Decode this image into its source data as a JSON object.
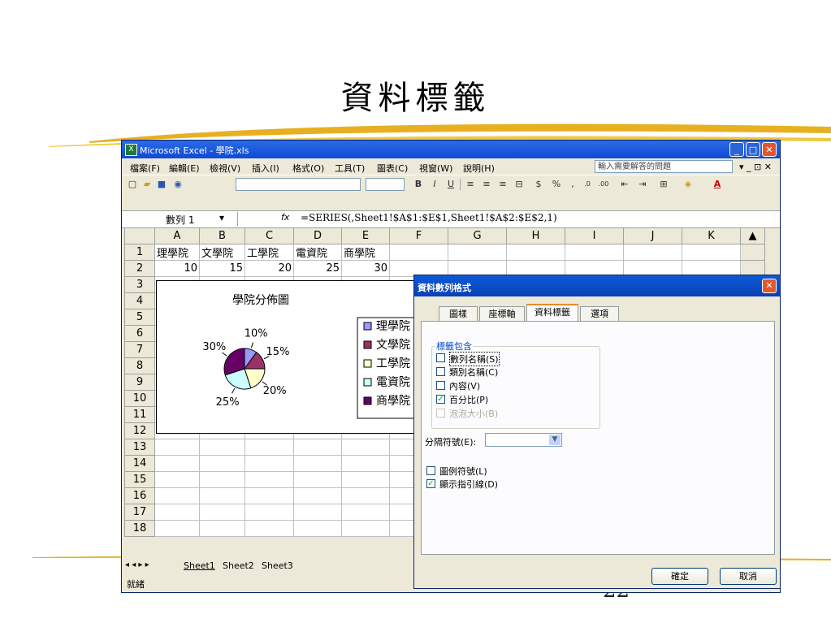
{
  "slide": {
    "title": "資料標籤",
    "page_number": "22"
  },
  "window": {
    "title": "Microsoft Excel - 學院.xls"
  },
  "menu": [
    "檔案(F)",
    "編輯(E)",
    "檢視(V)",
    "插入(I)",
    "格式(O)",
    "工具(T)",
    "圖表(C)",
    "視窗(W)",
    "說明(H)"
  ],
  "help_placeholder": "輸入需要解答的問題",
  "formula": {
    "name_box": "數列 1",
    "fx": "fx",
    "content": "=SERIES(,Sheet1!$A$1:$E$1,Sheet1!$A$2:$E$2,1)"
  },
  "columns": [
    "A",
    "B",
    "C",
    "D",
    "E",
    "F",
    "G",
    "H",
    "I",
    "J",
    "K"
  ],
  "rows": [
    "1",
    "2",
    "3",
    "4",
    "5",
    "6",
    "7",
    "8",
    "9",
    "10",
    "11",
    "12",
    "13",
    "14",
    "15",
    "16",
    "17",
    "18"
  ],
  "row1": [
    "理學院",
    "文學院",
    "工學院",
    "電資院",
    "商學院"
  ],
  "row2": [
    "10",
    "15",
    "20",
    "25",
    "30"
  ],
  "chart_data": {
    "type": "pie",
    "title": "學院分佈圖",
    "categories": [
      "理學院",
      "文學院",
      "工學院",
      "電資院",
      "商學院"
    ],
    "values": [
      10,
      15,
      20,
      25,
      30
    ],
    "data_labels": [
      "10%",
      "15%",
      "20%",
      "25%",
      "30%"
    ],
    "colors": [
      "#9999ff",
      "#993366",
      "#ffffcc",
      "#ccffff",
      "#660066"
    ],
    "legend": "right"
  },
  "sheet_tabs": [
    "Sheet1",
    "Sheet2",
    "Sheet3"
  ],
  "status": "就緒",
  "dialog": {
    "title": "資料數列格式",
    "tabs": [
      "圖樣",
      "座標軸",
      "資料標籤",
      "選項"
    ],
    "group_label": "標籤包含",
    "options": [
      {
        "label": "數列名稱(S)",
        "checked": false
      },
      {
        "label": "類別名稱(C)",
        "checked": false
      },
      {
        "label": "內容(V)",
        "checked": false
      },
      {
        "label": "百分比(P)",
        "checked": true
      },
      {
        "label": "泡泡大小(B)",
        "checked": false
      }
    ],
    "separator_label": "分隔符號(E):",
    "legend_key_label": "圖例符號(L)",
    "leader_lines_label": "顯示指引線(D)",
    "ok": "確定",
    "cancel": "取消"
  }
}
